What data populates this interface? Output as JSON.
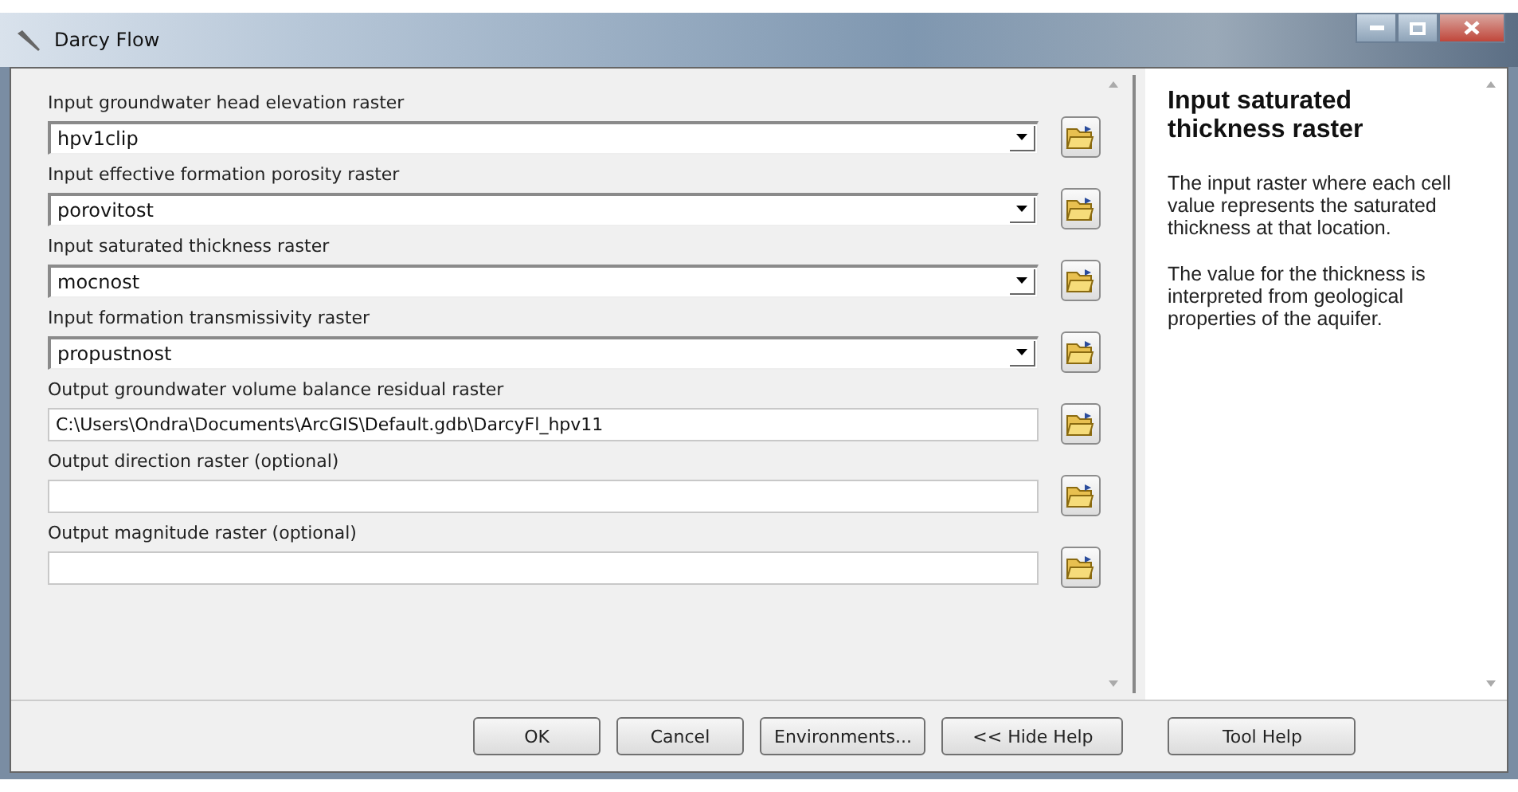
{
  "window": {
    "title": "Darcy Flow"
  },
  "parameters": [
    {
      "label": "Input groundwater head elevation raster",
      "kind": "combo",
      "value": "hpv1clip"
    },
    {
      "label": "Input effective formation porosity raster",
      "kind": "combo",
      "value": "porovitost"
    },
    {
      "label": "Input saturated thickness raster",
      "kind": "combo",
      "value": "mocnost"
    },
    {
      "label": "Input formation transmissivity raster",
      "kind": "combo",
      "value": "propustnost"
    },
    {
      "label": "Output groundwater volume balance residual raster",
      "kind": "text",
      "value": "C:\\Users\\Ondra\\Documents\\ArcGIS\\Default.gdb\\DarcyFl_hpv11"
    },
    {
      "label": "Output direction raster (optional)",
      "kind": "text"
    },
    {
      "label": "Output magnitude raster (optional)",
      "kind": "text"
    }
  ],
  "help": {
    "title": "Input saturated thickness raster",
    "paragraphs": [
      "The input raster where each cell value represents the saturated thickness at that location.",
      "The value for the thickness is interpreted from geological properties of the aquifer."
    ]
  },
  "buttons": [
    "OK",
    "Cancel",
    "Environments...",
    "<< Hide Help",
    "Tool Help"
  ]
}
